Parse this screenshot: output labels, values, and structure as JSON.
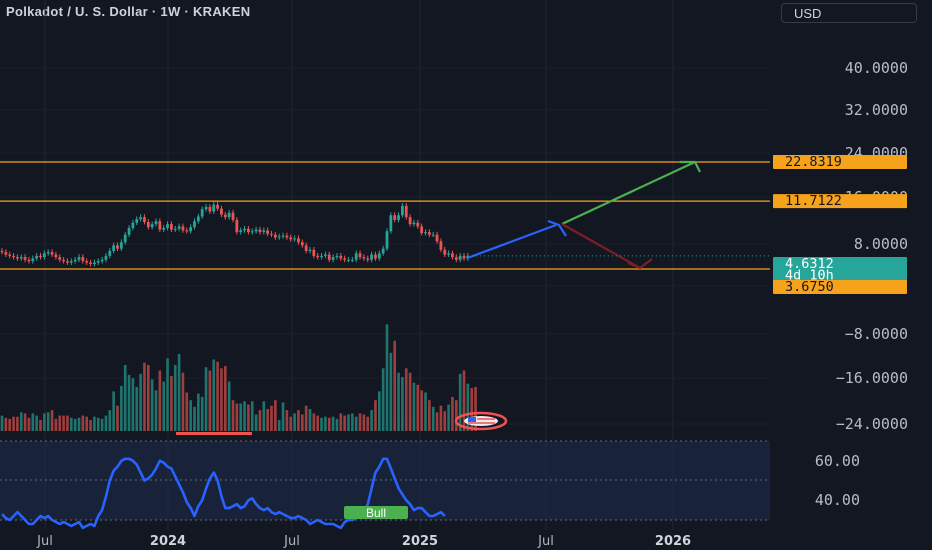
{
  "header": {
    "title": "Polkadot / U. S. Dollar · 1W · KRAKEN",
    "currency_label": "USD"
  },
  "colors": {
    "background": "#131722",
    "level_line": "#f7a21b",
    "up_candle": "#26a69a",
    "down_candle": "#ef5350",
    "projection_up": "#4caf50",
    "projection_down": "#7b1f24",
    "projection_blue": "#2962ff",
    "indicator_line": "#2962ff",
    "last_price_tag": "#26a69a"
  },
  "chart_data": [
    {
      "type": "candlestick",
      "scale": "logarithmic",
      "price_axis_ticks": [
        "40.0000",
        "32.0000",
        "24.0000",
        "16.0000",
        "8.0000",
        "−8.0000",
        "−16.0000",
        "−24.0000"
      ],
      "x_ticks": [
        "Jul",
        "2024",
        "Jul",
        "2025",
        "Jul",
        "2026"
      ],
      "horizontal_levels": [
        {
          "label": "22.8319",
          "value": 22.8319
        },
        {
          "label": "11.7122",
          "value": 11.7122
        },
        {
          "label": "3.6750",
          "value": 3.675
        }
      ],
      "last_price": {
        "value": "4.6312",
        "countdown": "4d 10h"
      },
      "close": [
        4.9,
        4.7,
        4.6,
        4.5,
        4.4,
        4.5,
        4.3,
        4.2,
        4.4,
        4.6,
        4.5,
        4.8,
        4.9,
        4.7,
        4.5,
        4.3,
        4.2,
        4.1,
        4.2,
        4.3,
        4.5,
        4.2,
        4.1,
        4.0,
        4.1,
        4.2,
        4.3,
        4.6,
        5.0,
        5.5,
        5.2,
        5.8,
        6.6,
        7.4,
        8.1,
        8.6,
        8.9,
        8.2,
        7.5,
        7.9,
        8.3,
        7.2,
        7.4,
        7.9,
        7.2,
        7.3,
        7.6,
        7.1,
        7.0,
        7.5,
        8.3,
        9.0,
        10.2,
        10.6,
        9.8,
        11.0,
        10.3,
        9.3,
        8.9,
        9.6,
        8.5,
        6.9,
        7.1,
        7.3,
        6.9,
        7.0,
        7.2,
        6.9,
        7.1,
        6.7,
        6.6,
        6.3,
        6.4,
        6.5,
        6.3,
        6.1,
        6.2,
        5.8,
        5.5,
        5.0,
        5.1,
        4.6,
        4.5,
        4.6,
        4.7,
        4.3,
        4.5,
        4.6,
        4.4,
        4.3,
        4.3,
        4.3,
        4.8,
        4.5,
        4.4,
        4.3,
        4.7,
        4.4,
        4.8,
        5.2,
        7.0,
        9.2,
        8.5,
        9.2,
        10.8,
        8.9,
        7.9,
        8.1,
        7.6,
        6.8,
        6.9,
        6.6,
        6.6,
        5.9,
        5.1,
        4.7,
        4.8,
        4.5,
        4.3,
        4.6,
        4.4,
        4.6
      ],
      "volume": [
        0.14,
        0.12,
        0.11,
        0.13,
        0.13,
        0.17,
        0.16,
        0.12,
        0.16,
        0.14,
        0.1,
        0.16,
        0.17,
        0.19,
        0.11,
        0.14,
        0.14,
        0.14,
        0.12,
        0.11,
        0.12,
        0.14,
        0.13,
        0.1,
        0.13,
        0.12,
        0.11,
        0.14,
        0.19,
        0.36,
        0.23,
        0.41,
        0.6,
        0.51,
        0.48,
        0.4,
        0.52,
        0.62,
        0.6,
        0.47,
        0.37,
        0.55,
        0.45,
        0.66,
        0.5,
        0.6,
        0.7,
        0.53,
        0.35,
        0.28,
        0.22,
        0.34,
        0.31,
        0.58,
        0.55,
        0.65,
        0.63,
        0.57,
        0.59,
        0.45,
        0.28,
        0.25,
        0.25,
        0.27,
        0.24,
        0.27,
        0.15,
        0.19,
        0.27,
        0.2,
        0.23,
        0.28,
        0.1,
        0.26,
        0.19,
        0.13,
        0.16,
        0.19,
        0.15,
        0.23,
        0.2,
        0.16,
        0.14,
        0.12,
        0.13,
        0.12,
        0.13,
        0.11,
        0.16,
        0.14,
        0.15,
        0.16,
        0.13,
        0.16,
        0.15,
        0.13,
        0.19,
        0.28,
        0.36,
        0.57,
        0.97,
        0.71,
        0.82,
        0.53,
        0.49,
        0.57,
        0.53,
        0.44,
        0.42,
        0.37,
        0.35,
        0.28,
        0.22,
        0.17,
        0.23,
        0.18,
        0.24,
        0.31,
        0.28,
        0.52,
        0.55,
        0.43,
        0.39,
        0.4
      ],
      "indicator": {
        "axis_ticks": [
          "60.00",
          "40.00"
        ],
        "label": "Bull",
        "values": [
          43,
          41,
          40,
          42,
          44,
          42,
          40,
          38,
          38,
          40,
          42,
          41,
          42,
          40,
          39,
          38,
          39,
          38,
          37,
          38,
          39,
          36,
          37,
          38,
          37,
          42,
          45,
          52,
          60,
          65,
          67,
          70,
          71,
          71,
          70,
          68,
          64,
          60,
          61,
          63,
          66,
          70,
          69,
          67,
          66,
          62,
          58,
          54,
          49,
          46,
          42,
          47,
          50,
          56,
          61,
          64,
          60,
          52,
          46,
          46,
          47,
          48,
          46,
          47,
          50,
          51,
          48,
          46,
          45,
          46,
          44,
          43,
          44,
          43,
          42,
          41,
          41,
          42,
          41,
          40,
          38,
          39,
          40,
          39,
          38,
          38,
          38,
          37,
          36,
          39,
          40,
          40,
          41,
          43,
          44,
          48,
          56,
          64,
          67,
          71,
          71,
          66,
          61,
          56,
          53,
          50,
          48,
          45,
          46,
          46,
          44,
          42,
          42,
          43,
          44,
          42
        ]
      }
    }
  ]
}
